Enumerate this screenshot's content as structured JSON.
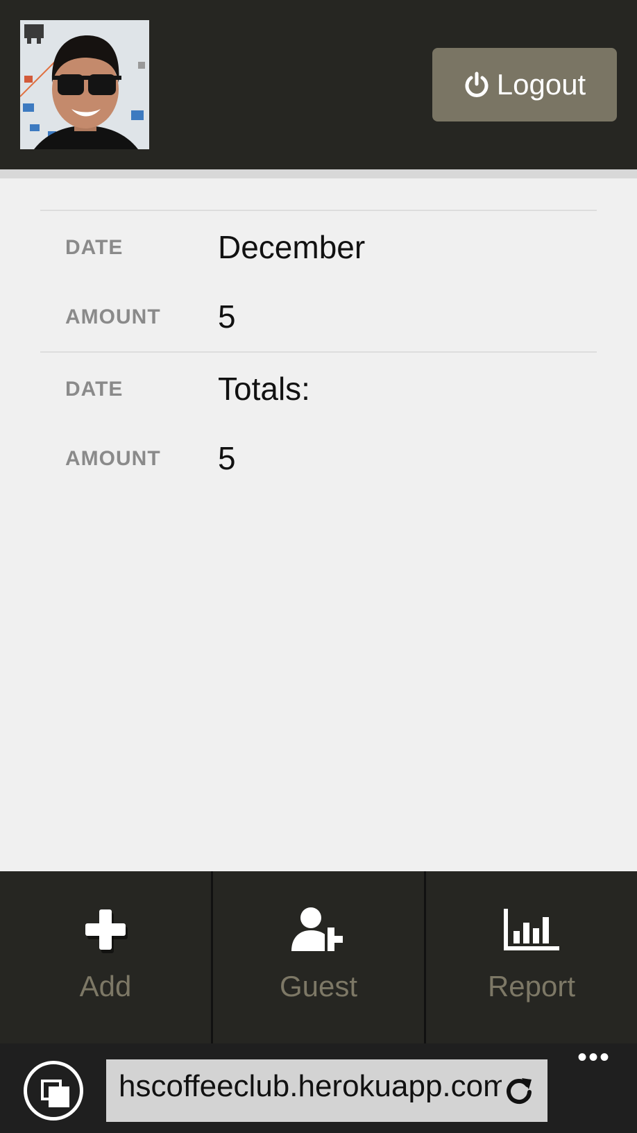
{
  "header": {
    "logout_label": "Logout",
    "logout_icon": "power-icon"
  },
  "records": [
    {
      "date_label": "DATE",
      "date_value": "December",
      "amount_label": "AMOUNT",
      "amount_value": "5"
    },
    {
      "date_label": "DATE",
      "date_value": "Totals:",
      "amount_label": "AMOUNT",
      "amount_value": "5"
    }
  ],
  "bottom_nav": {
    "items": [
      {
        "label": "Add",
        "icon": "plus-icon"
      },
      {
        "label": "Guest",
        "icon": "add-user-icon"
      },
      {
        "label": "Report",
        "icon": "bar-chart-icon"
      }
    ]
  },
  "browser": {
    "url": "hscoffeeclub.herokuapp.com",
    "more_label": "•••",
    "icons": [
      "tabs-icon",
      "refresh-icon",
      "more-icon"
    ]
  },
  "colors": {
    "header_bg": "#262622",
    "logout_bg": "#7a7564",
    "nav_label": "#7d7866",
    "content_bg": "#f0f0f0"
  }
}
